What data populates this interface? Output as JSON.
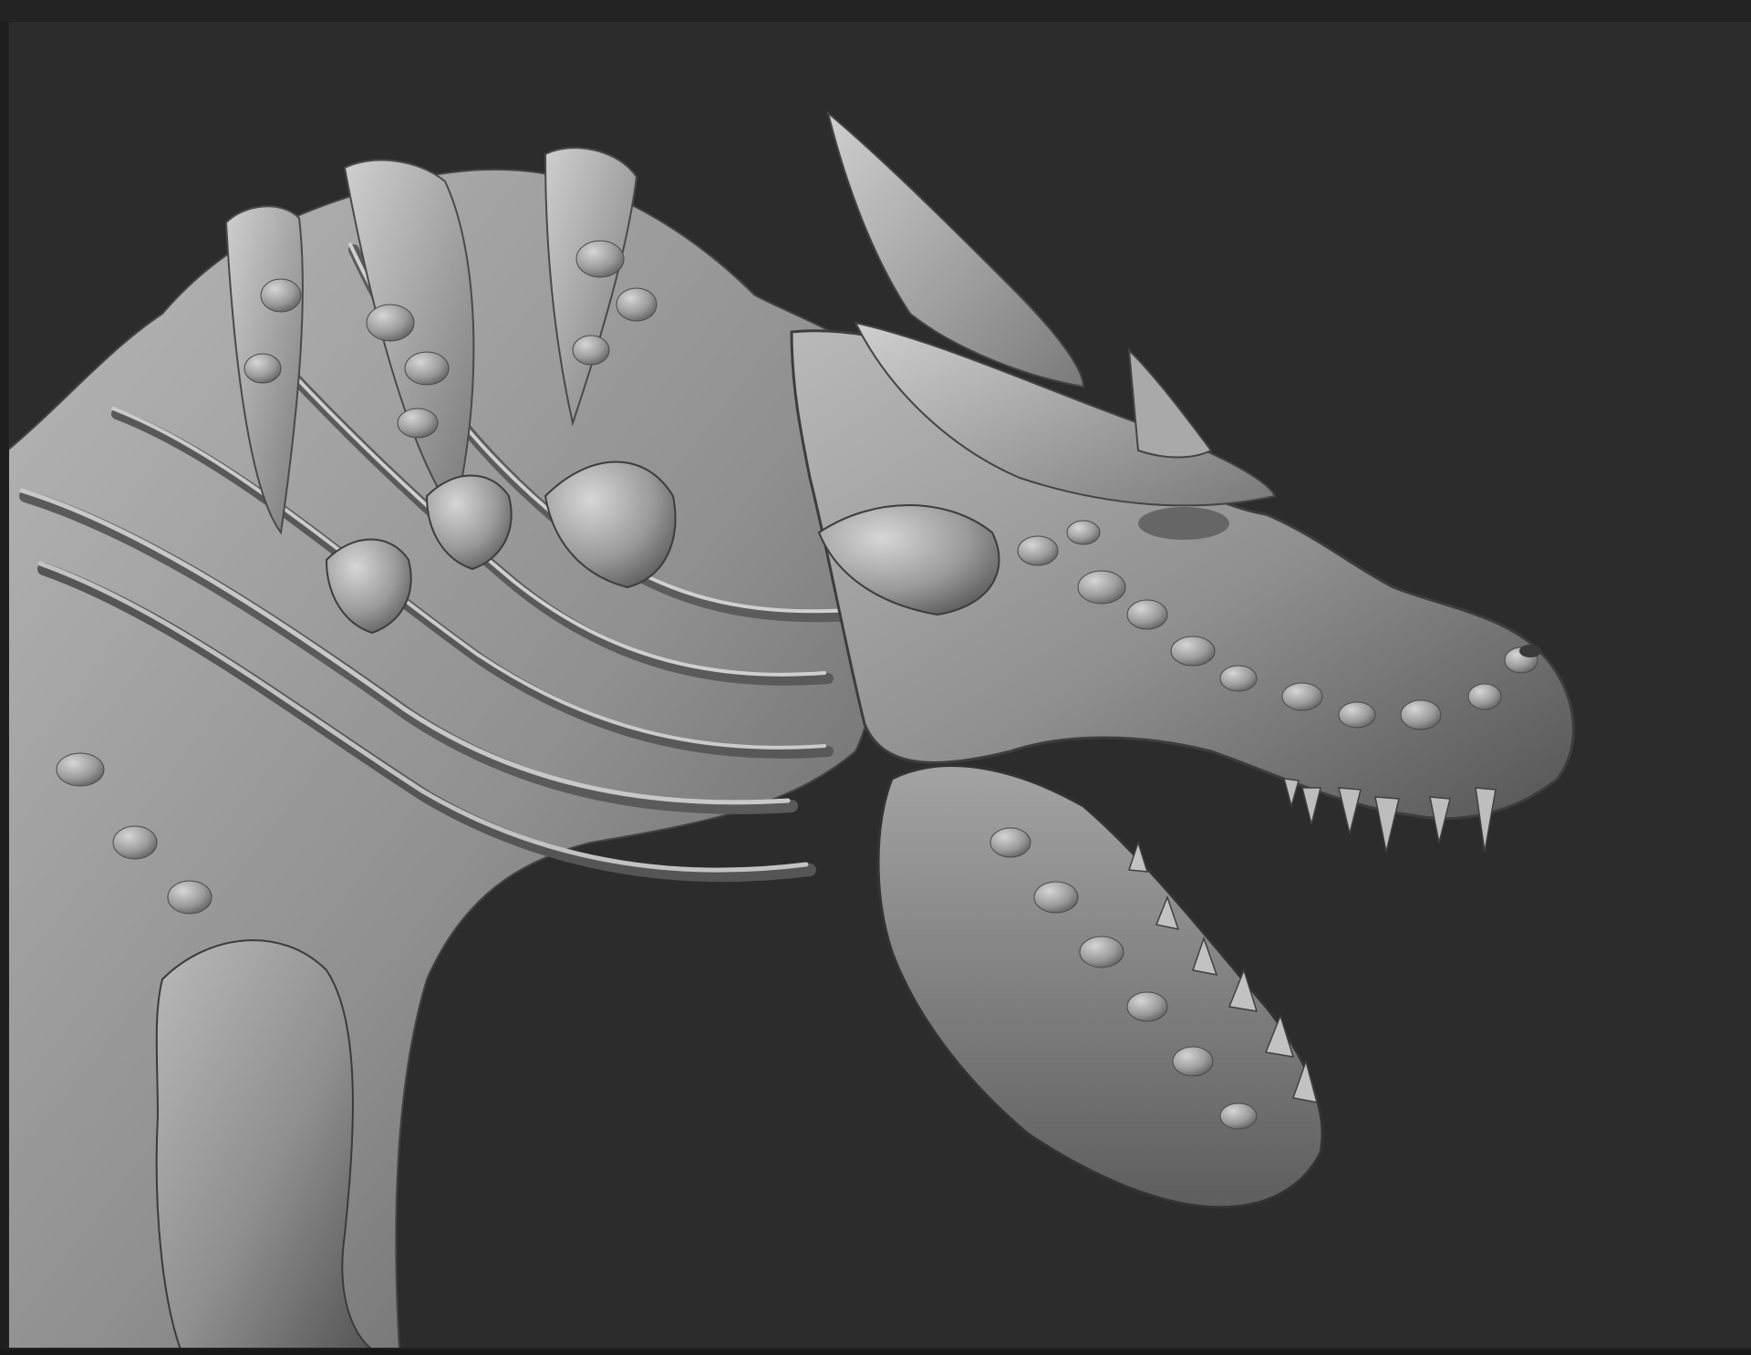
{
  "app": {
    "window": "3d-sculpting-viewport",
    "viewport_background": "#2c2c2c",
    "frame_color": "#1e1e1e",
    "model_material_color": "#8e8e8e",
    "model_highlight_color": "#c4c4c4",
    "model_shadow_color": "#3f3f3f"
  },
  "viewport": {
    "subject": "dragon-head-sculpt"
  }
}
